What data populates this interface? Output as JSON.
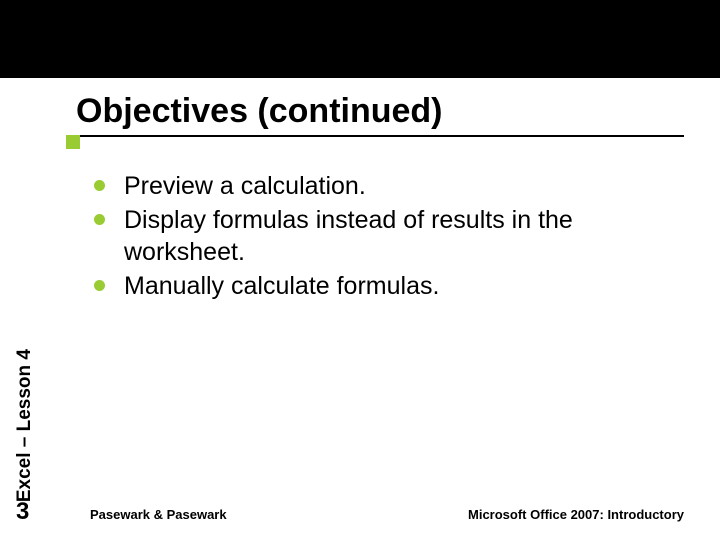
{
  "title": "Objectives (continued)",
  "sidebar_label": "Excel – Lesson 4",
  "bullets": [
    "Preview a calculation.",
    "Display formulas instead of results in the worksheet.",
    "Manually calculate formulas."
  ],
  "page_number": "3",
  "footer_left": "Pasewark & Pasewark",
  "footer_right": "Microsoft Office 2007:  Introductory"
}
